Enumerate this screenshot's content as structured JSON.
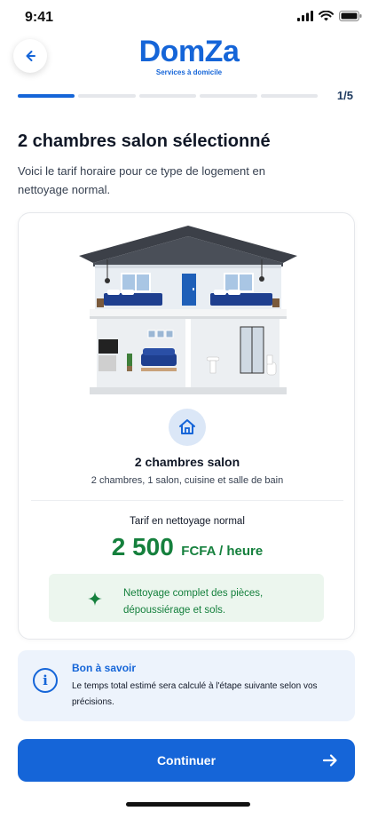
{
  "status_bar": {
    "time": "9:41"
  },
  "header": {
    "brand": "DomZa",
    "tagline": "Services à domicile"
  },
  "progress": {
    "label": "1/5",
    "current": 1,
    "total": 5
  },
  "page": {
    "title": "2 chambres salon sélectionné",
    "description": "Voici le tarif horaire pour ce type de logement en nettoyage normal."
  },
  "card": {
    "room_title": "2 chambres salon",
    "room_subtitle": "2 chambres, 1 salon, cuisine et salle de bain",
    "rate_label": "Tarif en nettoyage normal",
    "rate_amount": "2 500",
    "rate_unit": "FCFA / heure",
    "feature_text": "Nettoyage complet des pièces, dépoussiérage et sols."
  },
  "info": {
    "title": "Bon à savoir",
    "text": "Le temps total estimé sera calculé à l'étape suivante selon vos précisions."
  },
  "actions": {
    "continue_label": "Continuer"
  },
  "icons": {
    "back": "arrow-left-icon",
    "home": "home-icon",
    "sparkle": "sparkle-icon",
    "info": "info-icon",
    "continue": "arrow-right-icon"
  },
  "colors": {
    "primary": "#1565d8",
    "price_green": "#15803d",
    "feature_bg": "#ecf6ee",
    "info_bg": "#edf3fc"
  }
}
